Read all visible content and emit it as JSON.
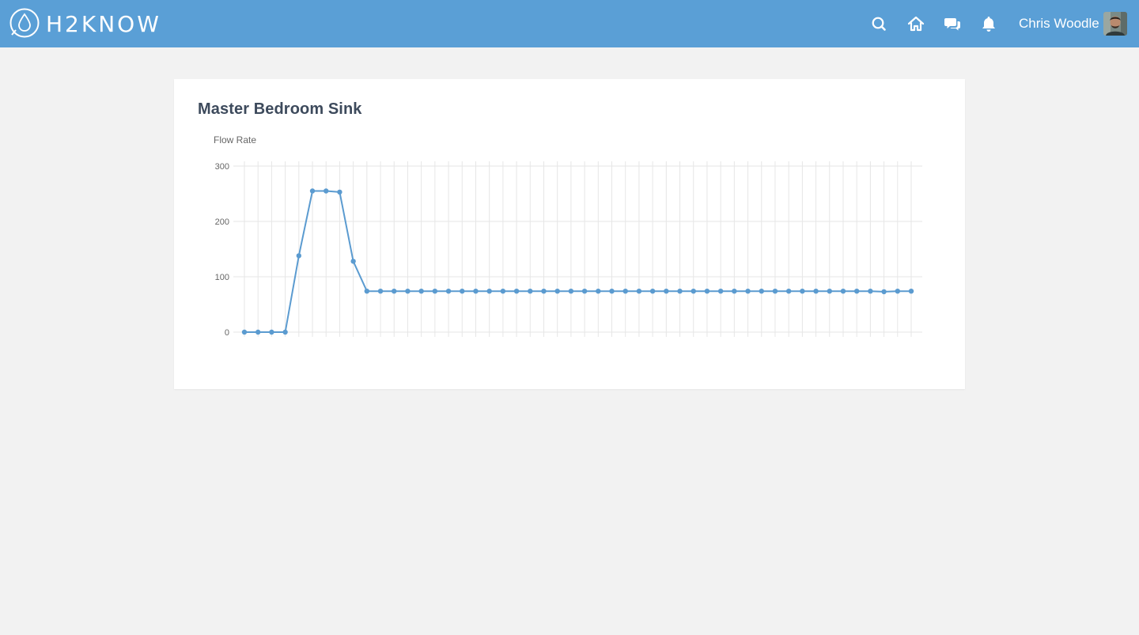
{
  "header": {
    "brand": "H2KNOW",
    "user_name": "Chris Woodle",
    "icons": [
      "search-icon",
      "home-icon",
      "chat-icon",
      "bell-icon"
    ]
  },
  "card": {
    "title": "Master Bedroom Sink"
  },
  "colors": {
    "header": "#5a9fd6",
    "background": "#f2f2f2",
    "line": "#5b9bd0",
    "title": "#3d4a5c"
  },
  "chart_data": {
    "type": "line",
    "ylabel": "Flow Rate",
    "xlabel": "",
    "ylim": [
      0,
      300
    ],
    "yticks": [
      0,
      100,
      200,
      300
    ],
    "grid": true,
    "series": [
      {
        "values": [
          0,
          0,
          0,
          0,
          138,
          255,
          255,
          253,
          128,
          74,
          74,
          74,
          74,
          74,
          74,
          74,
          74,
          74,
          74,
          74,
          74,
          74,
          74,
          74,
          74,
          74,
          74,
          74,
          74,
          74,
          74,
          74,
          74,
          74,
          74,
          74,
          74,
          74,
          74,
          74,
          74,
          74,
          74,
          74,
          74,
          74,
          74,
          73,
          74,
          74
        ]
      }
    ]
  }
}
